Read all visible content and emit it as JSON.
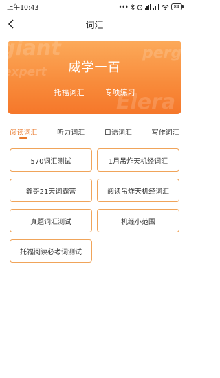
{
  "status_bar": {
    "time": "上午10:43",
    "dots": "•••",
    "icons": [
      "bluetooth-icon",
      "alarm-icon",
      "signal-icon",
      "signal-icon",
      "wifi-icon"
    ],
    "battery": "84"
  },
  "header": {
    "title": "词汇",
    "back_icon": "chevron-left-icon"
  },
  "banner": {
    "title": "威学一百",
    "links": [
      "托福词汇",
      "专项练习"
    ],
    "watermarks": [
      "giant",
      "expert",
      "perg",
      "Elera"
    ]
  },
  "tabs": [
    {
      "label": "阅读词汇",
      "active": true
    },
    {
      "label": "听力词汇",
      "active": false
    },
    {
      "label": "口语词汇",
      "active": false
    },
    {
      "label": "写作词汇",
      "active": false
    }
  ],
  "items": [
    "570词汇测试",
    "1月吊炸天机经词汇",
    "鑫哥21天词霸营",
    "阅读吊炸天机经词汇",
    "真题词汇测试",
    "机经小范围",
    "托福阅读必考词测试"
  ],
  "colors": {
    "accent": "#e8772a",
    "banner_top": "#fcaa5a",
    "banner_bottom": "#f5772a",
    "item_border": "#f0a45a"
  }
}
